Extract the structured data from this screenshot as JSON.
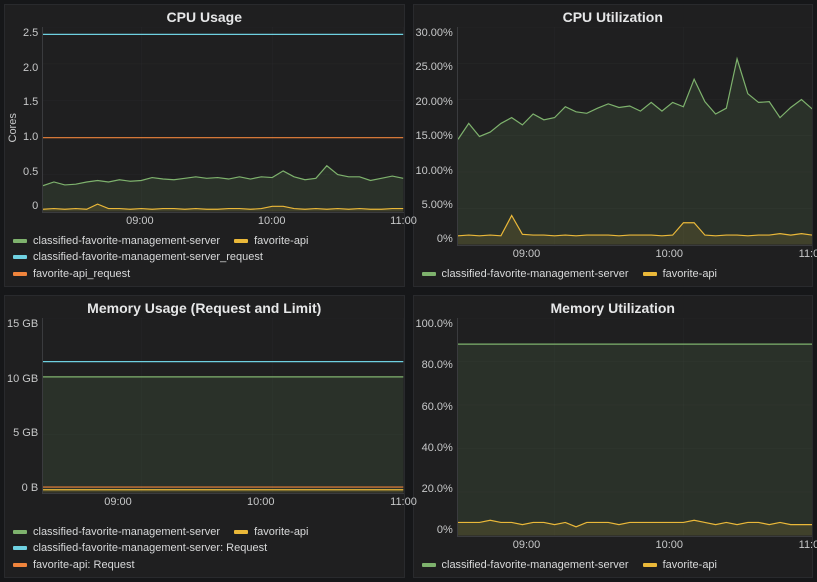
{
  "time_axis": {
    "start_min": 495,
    "end_min": 660,
    "ticks": [
      "09:00",
      "10:00",
      "11:00"
    ],
    "tick_min": [
      540,
      600,
      660
    ]
  },
  "colors": {
    "green": "#7eb26d",
    "yellow": "#eab839",
    "cyan": "#6ed0e0",
    "orange": "#ef843c"
  },
  "panels": [
    {
      "id": "cpu-usage",
      "title": "CPU Usage",
      "ylabel": "Cores",
      "ylim": [
        0,
        2.5
      ],
      "yticks": [
        "2.5",
        "2.0",
        "1.5",
        "1.0",
        "0.5",
        "0"
      ],
      "legend_layout": [
        [
          0,
          1
        ],
        [
          2
        ],
        [
          3
        ]
      ],
      "chart_data": {
        "type": "line",
        "title": "CPU Usage",
        "xlabel": "",
        "ylabel": "Cores",
        "ylim": [
          0,
          2.5
        ],
        "x_min": [
          495,
          500,
          505,
          510,
          515,
          520,
          525,
          530,
          535,
          540,
          545,
          550,
          555,
          560,
          565,
          570,
          575,
          580,
          585,
          590,
          595,
          600,
          605,
          610,
          615,
          620,
          625,
          630,
          635,
          640,
          645,
          650,
          655,
          660
        ],
        "series": [
          {
            "name": "classified-favorite-management-server",
            "colorKey": "green",
            "values": [
              0.35,
              0.4,
              0.36,
              0.37,
              0.4,
              0.42,
              0.4,
              0.43,
              0.41,
              0.42,
              0.46,
              0.44,
              0.43,
              0.45,
              0.47,
              0.45,
              0.46,
              0.44,
              0.47,
              0.44,
              0.47,
              0.46,
              0.55,
              0.47,
              0.43,
              0.45,
              0.62,
              0.5,
              0.47,
              0.47,
              0.42,
              0.45,
              0.48,
              0.45
            ],
            "fill": true
          },
          {
            "name": "favorite-api",
            "colorKey": "yellow",
            "values": [
              0.03,
              0.04,
              0.03,
              0.04,
              0.03,
              0.1,
              0.04,
              0.04,
              0.03,
              0.04,
              0.03,
              0.04,
              0.04,
              0.03,
              0.04,
              0.03,
              0.03,
              0.04,
              0.04,
              0.03,
              0.04,
              0.07,
              0.07,
              0.04,
              0.03,
              0.04,
              0.03,
              0.04,
              0.03,
              0.04,
              0.03,
              0.03,
              0.04,
              0.04
            ],
            "fill": true
          },
          {
            "name": "classified-favorite-management-server_request",
            "colorKey": "cyan",
            "values": [
              2.4,
              2.4,
              2.4,
              2.4,
              2.4,
              2.4,
              2.4,
              2.4,
              2.4,
              2.4,
              2.4,
              2.4,
              2.4,
              2.4,
              2.4,
              2.4,
              2.4,
              2.4,
              2.4,
              2.4,
              2.4,
              2.4,
              2.4,
              2.4,
              2.4,
              2.4,
              2.4,
              2.4,
              2.4,
              2.4,
              2.4,
              2.4,
              2.4,
              2.4
            ],
            "fill": false
          },
          {
            "name": "favorite-api_request",
            "colorKey": "orange",
            "values": [
              1.0,
              1.0,
              1.0,
              1.0,
              1.0,
              1.0,
              1.0,
              1.0,
              1.0,
              1.0,
              1.0,
              1.0,
              1.0,
              1.0,
              1.0,
              1.0,
              1.0,
              1.0,
              1.0,
              1.0,
              1.0,
              1.0,
              1.0,
              1.0,
              1.0,
              1.0,
              1.0,
              1.0,
              1.0,
              1.0,
              1.0,
              1.0,
              1.0,
              1.0
            ],
            "fill": false
          }
        ]
      }
    },
    {
      "id": "cpu-util",
      "title": "CPU Utilization",
      "ylabel": "",
      "ylim": [
        0,
        30
      ],
      "yticks": [
        "30.00%",
        "25.00%",
        "20.00%",
        "15.00%",
        "10.00%",
        "5.00%",
        "0%"
      ],
      "legend_layout": [
        [
          0,
          1
        ]
      ],
      "chart_data": {
        "type": "line",
        "title": "CPU Utilization",
        "xlabel": "",
        "ylabel": "",
        "ylim": [
          0,
          30
        ],
        "x_min": [
          495,
          500,
          505,
          510,
          515,
          520,
          525,
          530,
          535,
          540,
          545,
          550,
          555,
          560,
          565,
          570,
          575,
          580,
          585,
          590,
          595,
          600,
          605,
          610,
          615,
          620,
          625,
          630,
          635,
          640,
          645,
          650,
          655,
          660
        ],
        "series": [
          {
            "name": "classified-favorite-management-server",
            "colorKey": "green",
            "values": [
              14.5,
              16.7,
              14.9,
              15.5,
              16.7,
              17.5,
              16.5,
              18.0,
              17.2,
              17.5,
              19.0,
              18.3,
              18.1,
              18.8,
              19.4,
              18.9,
              19.1,
              18.4,
              19.6,
              18.4,
              19.6,
              19.0,
              22.8,
              19.7,
              18.0,
              18.8,
              25.6,
              20.8,
              19.6,
              19.7,
              17.5,
              18.9,
              20.0,
              18.7
            ],
            "fill": true
          },
          {
            "name": "favorite-api",
            "colorKey": "yellow",
            "values": [
              1.2,
              1.3,
              1.2,
              1.3,
              1.2,
              4.0,
              1.4,
              1.3,
              1.3,
              1.2,
              1.3,
              1.2,
              1.3,
              1.3,
              1.3,
              1.2,
              1.3,
              1.3,
              1.3,
              1.2,
              1.3,
              3.0,
              3.0,
              1.3,
              1.2,
              1.3,
              1.3,
              1.2,
              1.3,
              1.3,
              1.5,
              1.3,
              1.5,
              1.3
            ],
            "fill": true
          }
        ]
      }
    },
    {
      "id": "mem-usage",
      "title": "Memory Usage (Request and Limit)",
      "ylabel": "",
      "ylim": [
        0,
        16
      ],
      "yticks": [
        "15 GB",
        "10 GB",
        "5 GB",
        "0 B"
      ],
      "legend_layout": [
        [
          0,
          1
        ],
        [
          2
        ],
        [
          3
        ]
      ],
      "chart_data": {
        "type": "line",
        "title": "Memory Usage (Request and Limit)",
        "xlabel": "",
        "ylabel": "",
        "ylim": [
          0,
          16
        ],
        "x_min": [
          495,
          500,
          505,
          510,
          515,
          520,
          525,
          530,
          535,
          540,
          545,
          550,
          555,
          560,
          565,
          570,
          575,
          580,
          585,
          590,
          595,
          600,
          605,
          610,
          615,
          620,
          625,
          630,
          635,
          640,
          645,
          650,
          655,
          660
        ],
        "series": [
          {
            "name": "classified-favorite-management-server",
            "colorKey": "green",
            "values": [
              10.6,
              10.6,
              10.6,
              10.6,
              10.6,
              10.6,
              10.6,
              10.6,
              10.6,
              10.6,
              10.6,
              10.6,
              10.6,
              10.6,
              10.6,
              10.6,
              10.6,
              10.6,
              10.6,
              10.6,
              10.6,
              10.6,
              10.6,
              10.6,
              10.6,
              10.6,
              10.6,
              10.6,
              10.6,
              10.6,
              10.6,
              10.6,
              10.6,
              10.6
            ],
            "fill": true
          },
          {
            "name": "favorite-api",
            "colorKey": "yellow",
            "values": [
              0.25,
              0.25,
              0.25,
              0.25,
              0.25,
              0.25,
              0.25,
              0.25,
              0.25,
              0.25,
              0.25,
              0.25,
              0.25,
              0.25,
              0.25,
              0.25,
              0.25,
              0.25,
              0.25,
              0.25,
              0.25,
              0.25,
              0.25,
              0.25,
              0.25,
              0.25,
              0.25,
              0.25,
              0.25,
              0.25,
              0.25,
              0.25,
              0.25,
              0.25
            ],
            "fill": true
          },
          {
            "name": "classified-favorite-management-server: Request",
            "colorKey": "cyan",
            "values": [
              12.0,
              12.0,
              12.0,
              12.0,
              12.0,
              12.0,
              12.0,
              12.0,
              12.0,
              12.0,
              12.0,
              12.0,
              12.0,
              12.0,
              12.0,
              12.0,
              12.0,
              12.0,
              12.0,
              12.0,
              12.0,
              12.0,
              12.0,
              12.0,
              12.0,
              12.0,
              12.0,
              12.0,
              12.0,
              12.0,
              12.0,
              12.0,
              12.0,
              12.0
            ],
            "fill": false
          },
          {
            "name": "favorite-api: Request",
            "colorKey": "orange",
            "values": [
              0.5,
              0.5,
              0.5,
              0.5,
              0.5,
              0.5,
              0.5,
              0.5,
              0.5,
              0.5,
              0.5,
              0.5,
              0.5,
              0.5,
              0.5,
              0.5,
              0.5,
              0.5,
              0.5,
              0.5,
              0.5,
              0.5,
              0.5,
              0.5,
              0.5,
              0.5,
              0.5,
              0.5,
              0.5,
              0.5,
              0.5,
              0.5,
              0.5,
              0.5
            ],
            "fill": false
          }
        ]
      }
    },
    {
      "id": "mem-util",
      "title": "Memory Utilization",
      "ylabel": "",
      "ylim": [
        0,
        100
      ],
      "yticks": [
        "100.0%",
        "80.0%",
        "60.0%",
        "40.0%",
        "20.0%",
        "0%"
      ],
      "legend_layout": [
        [
          0,
          1
        ]
      ],
      "chart_data": {
        "type": "line",
        "title": "Memory Utilization",
        "xlabel": "",
        "ylabel": "",
        "ylim": [
          0,
          100
        ],
        "x_min": [
          495,
          500,
          505,
          510,
          515,
          520,
          525,
          530,
          535,
          540,
          545,
          550,
          555,
          560,
          565,
          570,
          575,
          580,
          585,
          590,
          595,
          600,
          605,
          610,
          615,
          620,
          625,
          630,
          635,
          640,
          645,
          650,
          655,
          660
        ],
        "series": [
          {
            "name": "classified-favorite-management-server",
            "colorKey": "green",
            "values": [
              88,
              88,
              88,
              88,
              88,
              88,
              88,
              88,
              88,
              88,
              88,
              88,
              88,
              88,
              88,
              88,
              88,
              88,
              88,
              88,
              88,
              88,
              88,
              88,
              88,
              88,
              88,
              88,
              88,
              88,
              88,
              88,
              88,
              88
            ],
            "fill": true
          },
          {
            "name": "favorite-api",
            "colorKey": "yellow",
            "values": [
              6,
              6,
              6,
              7,
              6,
              6,
              5,
              6,
              6,
              5,
              6,
              4,
              6,
              6,
              6,
              5,
              6,
              6,
              6,
              6,
              6,
              6,
              7,
              6,
              5,
              6,
              5,
              6,
              6,
              5,
              6,
              5,
              5,
              5
            ],
            "fill": true
          }
        ]
      }
    }
  ]
}
